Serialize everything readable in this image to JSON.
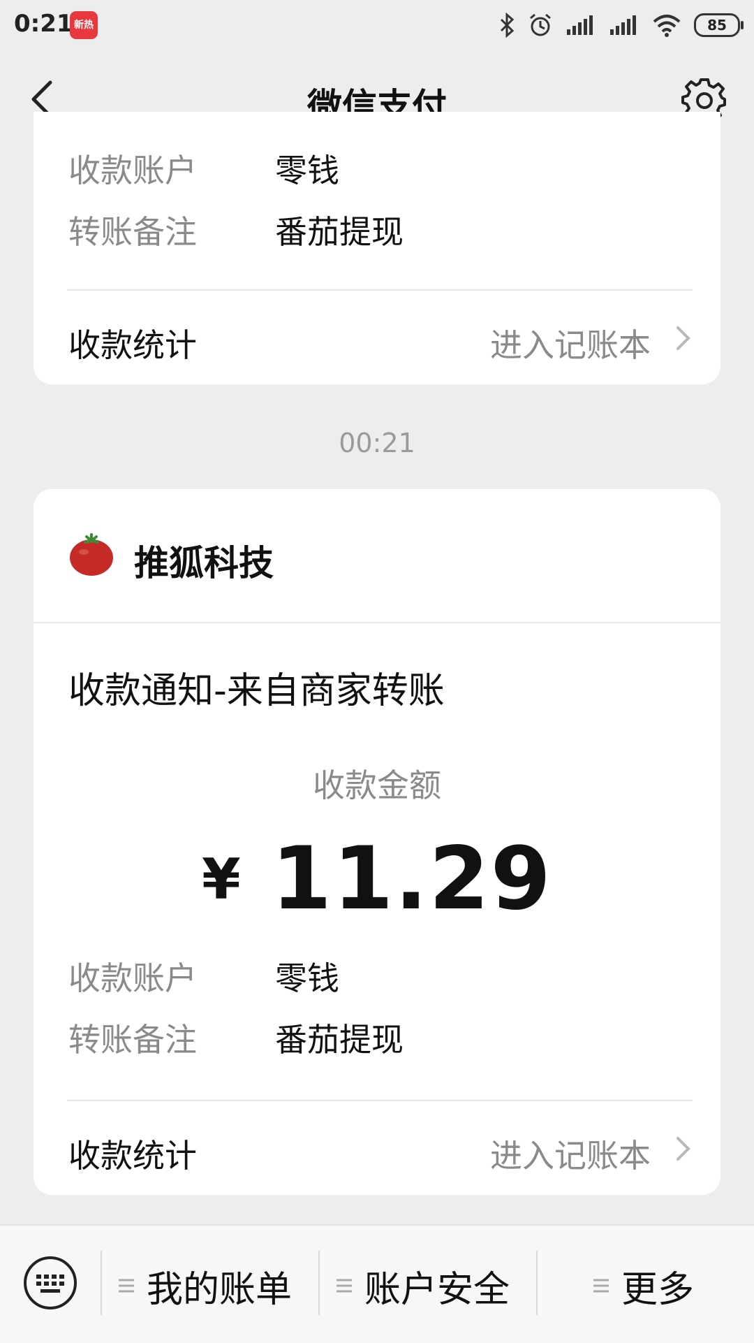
{
  "status_bar": {
    "time": "0:21",
    "app_badge": "新热",
    "battery": "85"
  },
  "nav": {
    "title": "微信支付"
  },
  "card_top": {
    "rows": [
      {
        "label": "收款账户",
        "value": "零钱"
      },
      {
        "label": "转账备注",
        "value": "番茄提现"
      }
    ],
    "stats_label": "收款统计",
    "stats_link": "进入记账本"
  },
  "timestamp": "00:21",
  "card_main": {
    "merchant": "推狐科技",
    "title": "收款通知-来自商家转账",
    "amount_label": "收款金额",
    "currency": "¥",
    "amount": "11.29",
    "rows": [
      {
        "label": "收款账户",
        "value": "零钱"
      },
      {
        "label": "转账备注",
        "value": "番茄提现"
      }
    ],
    "stats_label": "收款统计",
    "stats_link": "进入记账本"
  },
  "bottom_bar": {
    "items": [
      {
        "label": "我的账单",
        "icon": "menu-lines-icon"
      },
      {
        "label": "账户安全",
        "icon": "menu-lines-icon"
      },
      {
        "label": "更多",
        "icon": "menu-lines-icon"
      }
    ],
    "keyboard_icon": "keyboard-icon"
  }
}
